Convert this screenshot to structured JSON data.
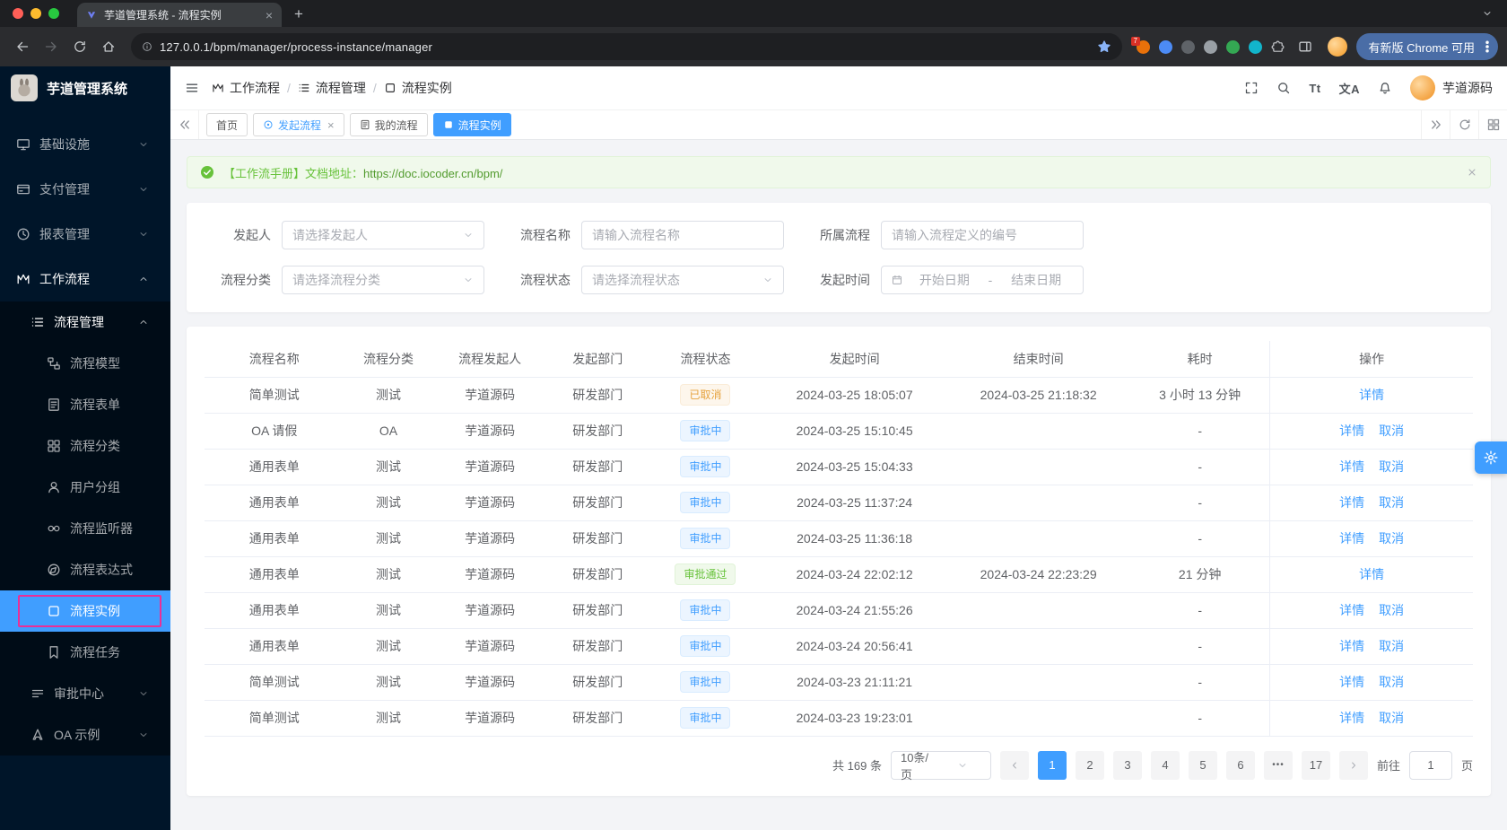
{
  "browser": {
    "tab_title": "芋道管理系统 - 流程实例",
    "url": "127.0.0.1/bpm/manager/process-instance/manager",
    "update_chip": "有新版 Chrome 可用",
    "extensions": [
      {
        "key": "grid",
        "color": "#e8710a",
        "badge": "7"
      },
      {
        "key": "pin",
        "color": "#4c8bf5"
      },
      {
        "key": "globe",
        "color": "#5f6368"
      },
      {
        "key": "circle",
        "color": "#9aa0a6"
      },
      {
        "key": "leaf",
        "color": "#34a853"
      },
      {
        "key": "shield",
        "color": "#12b5cb"
      },
      {
        "key": "puzzle",
        "color": "#c6c8cc"
      }
    ]
  },
  "sidebar": {
    "logo_title": "芋道管理系统",
    "menu": [
      {
        "key": "infrastructure",
        "label": "基础设施",
        "icon": "monitor",
        "level": 1,
        "arrow": "down"
      },
      {
        "key": "payment",
        "label": "支付管理",
        "icon": "card",
        "level": 1,
        "arrow": "down"
      },
      {
        "key": "report",
        "label": "报表管理",
        "icon": "clock",
        "level": 1,
        "arrow": "down"
      },
      {
        "key": "workflow",
        "label": "工作流程",
        "icon": "mflow",
        "level": 1,
        "arrow": "up",
        "open": true
      },
      {
        "key": "process-manage",
        "label": "流程管理",
        "icon": "listtree",
        "level": 2,
        "arrow": "up",
        "open": true
      },
      {
        "key": "process-model",
        "label": "流程模型",
        "icon": "model",
        "level": 3
      },
      {
        "key": "process-form",
        "label": "流程表单",
        "icon": "form",
        "level": 3
      },
      {
        "key": "process-category",
        "label": "流程分类",
        "icon": "category",
        "level": 3
      },
      {
        "key": "user-group",
        "label": "用户分组",
        "icon": "user",
        "level": 3
      },
      {
        "key": "process-listener",
        "label": "流程监听器",
        "icon": "listener",
        "level": 3
      },
      {
        "key": "process-expression",
        "label": "流程表达式",
        "icon": "expression",
        "level": 3
      },
      {
        "key": "process-instance",
        "label": "流程实例",
        "icon": "square",
        "level": 3,
        "active": true,
        "highlighted": true
      },
      {
        "key": "process-task",
        "label": "流程任务",
        "icon": "bookmark",
        "level": 3
      },
      {
        "key": "approval-center",
        "label": "审批中心",
        "icon": "audit",
        "level": 2,
        "arrow": "down"
      },
      {
        "key": "oa-example",
        "label": "OA 示例",
        "icon": "oa",
        "level": 2,
        "arrow": "down"
      }
    ]
  },
  "header": {
    "breadcrumb": [
      {
        "key": "workflow",
        "label": "工作流程",
        "icon": "mflow"
      },
      {
        "key": "process-manage",
        "label": "流程管理",
        "icon": "listtree"
      },
      {
        "key": "process-instance",
        "label": "流程实例",
        "icon": "square"
      }
    ],
    "font_icon": "Tt",
    "lang_icon": "文A",
    "username": "芋道源码"
  },
  "tags": [
    {
      "key": "home",
      "label": "首页"
    },
    {
      "key": "start-process",
      "label": "发起流程",
      "icon": "dotcircle",
      "closable": true,
      "link": true
    },
    {
      "key": "my-process",
      "label": "我的流程",
      "icon": "form"
    },
    {
      "key": "process-instance",
      "label": "流程实例",
      "icon": "sqfill",
      "active": true
    }
  ],
  "notice": {
    "text": "【工作流手册】文档地址：",
    "link": "https://doc.iocoder.cn/bpm/"
  },
  "filters": {
    "rows": [
      [
        {
          "key": "starter",
          "label": "发起人",
          "type": "select",
          "placeholder": "请选择发起人"
        },
        {
          "key": "process-name",
          "label": "流程名称",
          "type": "input",
          "placeholder": "请输入流程名称"
        },
        {
          "key": "process-def",
          "label": "所属流程",
          "type": "input",
          "placeholder": "请输入流程定义的编号"
        }
      ],
      [
        {
          "key": "category",
          "label": "流程分类",
          "type": "select",
          "placeholder": "请选择流程分类"
        },
        {
          "key": "status",
          "label": "流程状态",
          "type": "select",
          "placeholder": "请选择流程状态"
        },
        {
          "key": "start-time",
          "label": "发起时间",
          "type": "daterange",
          "start_placeholder": "开始日期",
          "separator": "-",
          "end_placeholder": "结束日期"
        }
      ]
    ]
  },
  "table": {
    "columns": [
      {
        "key": "name",
        "label": "流程名称"
      },
      {
        "key": "category",
        "label": "流程分类"
      },
      {
        "key": "starter",
        "label": "流程发起人"
      },
      {
        "key": "dept",
        "label": "发起部门"
      },
      {
        "key": "status",
        "label": "流程状态"
      },
      {
        "key": "start_time",
        "label": "发起时间"
      },
      {
        "key": "end_time",
        "label": "结束时间"
      },
      {
        "key": "duration",
        "label": "耗时"
      },
      {
        "key": "ops",
        "label": "操作"
      }
    ],
    "rows": [
      {
        "name": "简单测试",
        "category": "测试",
        "starter": "芋道源码",
        "dept": "研发部门",
        "status": "已取消",
        "status_type": "warning",
        "start_time": "2024-03-25 18:05:07",
        "end_time": "2024-03-25 21:18:32",
        "duration": "3 小时 13 分钟",
        "actions": [
          {
            "key": "detail",
            "label": "详情"
          }
        ]
      },
      {
        "name": "OA 请假",
        "category": "OA",
        "starter": "芋道源码",
        "dept": "研发部门",
        "status": "审批中",
        "status_type": "primary",
        "start_time": "2024-03-25 15:10:45",
        "end_time": "",
        "duration": "-",
        "actions": [
          {
            "key": "detail",
            "label": "详情"
          },
          {
            "key": "cancel",
            "label": "取消"
          }
        ]
      },
      {
        "name": "通用表单",
        "category": "测试",
        "starter": "芋道源码",
        "dept": "研发部门",
        "status": "审批中",
        "status_type": "primary",
        "start_time": "2024-03-25 15:04:33",
        "end_time": "",
        "duration": "-",
        "actions": [
          {
            "key": "detail",
            "label": "详情"
          },
          {
            "key": "cancel",
            "label": "取消"
          }
        ]
      },
      {
        "name": "通用表单",
        "category": "测试",
        "starter": "芋道源码",
        "dept": "研发部门",
        "status": "审批中",
        "status_type": "primary",
        "start_time": "2024-03-25 11:37:24",
        "end_time": "",
        "duration": "-",
        "actions": [
          {
            "key": "detail",
            "label": "详情"
          },
          {
            "key": "cancel",
            "label": "取消"
          }
        ]
      },
      {
        "name": "通用表单",
        "category": "测试",
        "starter": "芋道源码",
        "dept": "研发部门",
        "status": "审批中",
        "status_type": "primary",
        "start_time": "2024-03-25 11:36:18",
        "end_time": "",
        "duration": "-",
        "actions": [
          {
            "key": "detail",
            "label": "详情"
          },
          {
            "key": "cancel",
            "label": "取消"
          }
        ]
      },
      {
        "name": "通用表单",
        "category": "测试",
        "starter": "芋道源码",
        "dept": "研发部门",
        "status": "审批通过",
        "status_type": "success",
        "start_time": "2024-03-24 22:02:12",
        "end_time": "2024-03-24 22:23:29",
        "duration": "21 分钟",
        "actions": [
          {
            "key": "detail",
            "label": "详情"
          }
        ]
      },
      {
        "name": "通用表单",
        "category": "测试",
        "starter": "芋道源码",
        "dept": "研发部门",
        "status": "审批中",
        "status_type": "primary",
        "start_time": "2024-03-24 21:55:26",
        "end_time": "",
        "duration": "-",
        "actions": [
          {
            "key": "detail",
            "label": "详情"
          },
          {
            "key": "cancel",
            "label": "取消"
          }
        ]
      },
      {
        "name": "通用表单",
        "category": "测试",
        "starter": "芋道源码",
        "dept": "研发部门",
        "status": "审批中",
        "status_type": "primary",
        "start_time": "2024-03-24 20:56:41",
        "end_time": "",
        "duration": "-",
        "actions": [
          {
            "key": "detail",
            "label": "详情"
          },
          {
            "key": "cancel",
            "label": "取消"
          }
        ]
      },
      {
        "name": "简单测试",
        "category": "测试",
        "starter": "芋道源码",
        "dept": "研发部门",
        "status": "审批中",
        "status_type": "primary",
        "start_time": "2024-03-23 21:11:21",
        "end_time": "",
        "duration": "-",
        "actions": [
          {
            "key": "detail",
            "label": "详情"
          },
          {
            "key": "cancel",
            "label": "取消"
          }
        ]
      },
      {
        "name": "简单测试",
        "category": "测试",
        "starter": "芋道源码",
        "dept": "研发部门",
        "status": "审批中",
        "status_type": "primary",
        "start_time": "2024-03-23 19:23:01",
        "end_time": "",
        "duration": "-",
        "actions": [
          {
            "key": "detail",
            "label": "详情"
          },
          {
            "key": "cancel",
            "label": "取消"
          }
        ]
      }
    ]
  },
  "pagination": {
    "total": "共 169 条",
    "page_size": "10条/页",
    "pages": [
      "1",
      "2",
      "3",
      "4",
      "5",
      "6",
      "•••",
      "17"
    ],
    "active_page": "1",
    "goto_label": "前往",
    "goto_value": "1",
    "goto_unit": "页"
  },
  "colors": {
    "primary": "#409eff",
    "success": "#67c23a",
    "warning": "#e6a23c",
    "sidebar_bg": "#001529",
    "highlight_pink": "#eb2f96"
  }
}
